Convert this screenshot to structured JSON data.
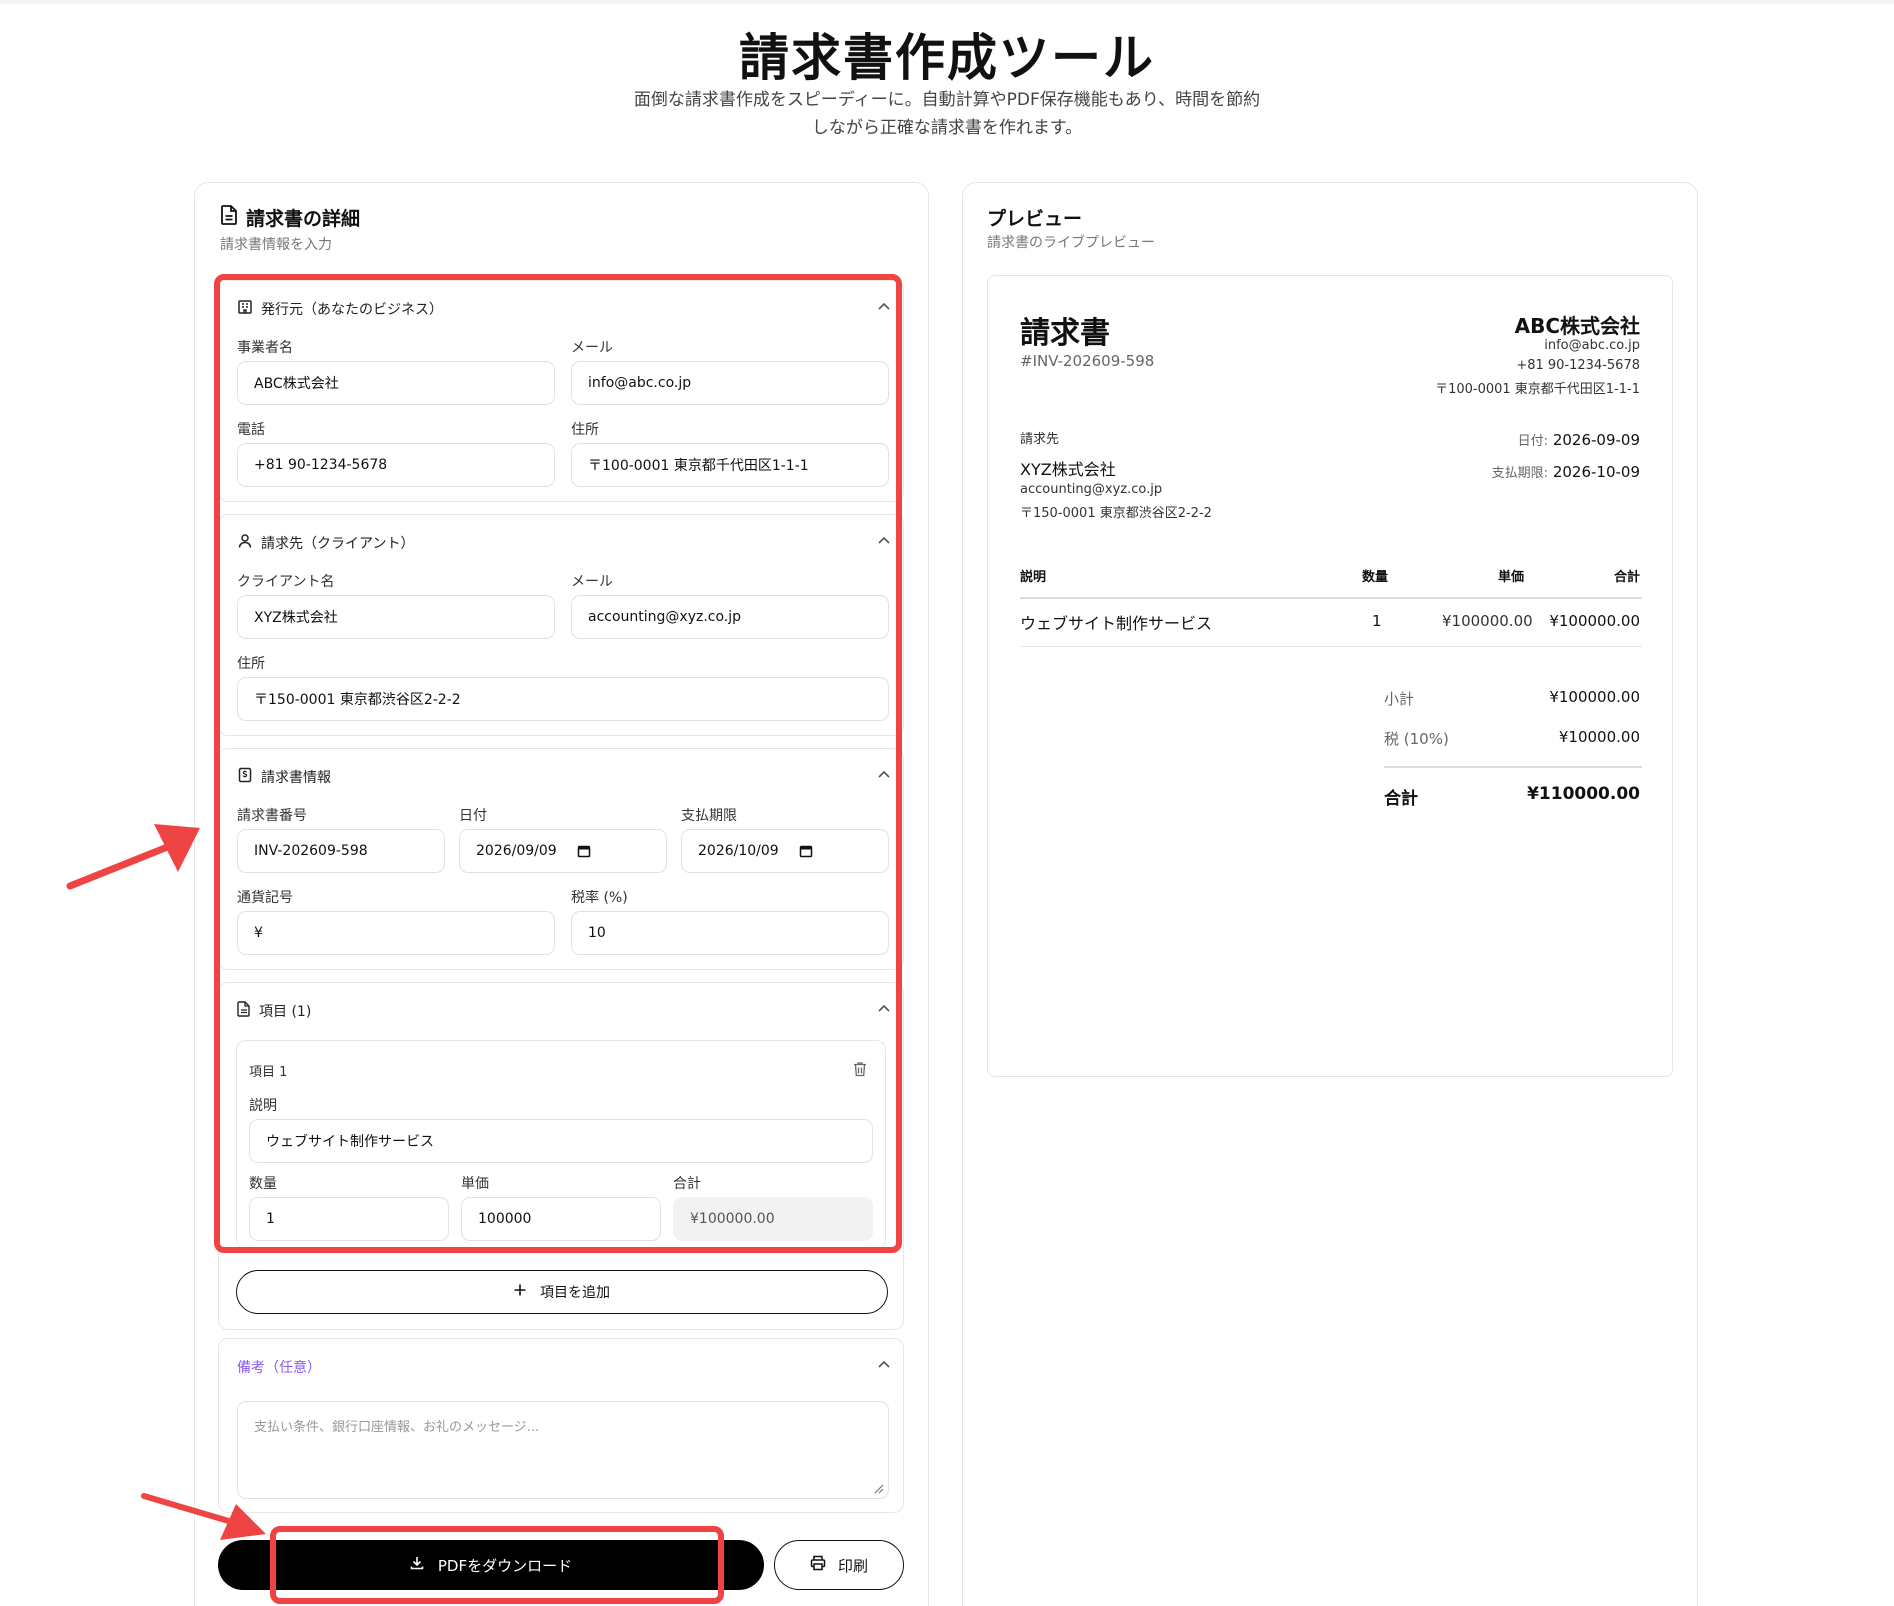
{
  "page": {
    "title": "請求書作成ツール",
    "subtitle_line1": "面倒な請求書作成をスピーディーに。自動計算やPDF保存機能もあり、時間を節約",
    "subtitle_line2": "しながら正確な請求書を作れます。"
  },
  "form": {
    "title": "請求書の詳細",
    "subtitle": "請求書情報を入力",
    "issuer": {
      "section_title": "発行元（あなたのビジネス）",
      "business_name_label": "事業者名",
      "business_name": "ABC株式会社",
      "email_label": "メール",
      "email": "info@abc.co.jp",
      "phone_label": "電話",
      "phone": "+81 90-1234-5678",
      "address_label": "住所",
      "address": "〒100-0001 東京都千代田区1-1-1"
    },
    "client": {
      "section_title": "請求先（クライアント）",
      "name_label": "クライアント名",
      "name": "XYZ株式会社",
      "email_label": "メール",
      "email": "accounting@xyz.co.jp",
      "address_label": "住所",
      "address": "〒150-0001 東京都渋谷区2-2-2"
    },
    "invoice": {
      "section_title": "請求書情報",
      "number_label": "請求書番号",
      "number": "INV-202609-598",
      "date_label": "日付",
      "date": "2026/09/09",
      "due_label": "支払期限",
      "due": "2026/10/09",
      "currency_label": "通貨記号",
      "currency": "¥",
      "tax_label": "税率 (%)",
      "tax": "10"
    },
    "items": {
      "section_title": "項目 (1)",
      "item_title": "項目 1",
      "description_label": "説明",
      "description": "ウェブサイト制作サービス",
      "qty_label": "数量",
      "qty": "1",
      "price_label": "単価",
      "price": "100000",
      "total_label": "合計",
      "total": "¥100000.00",
      "add_button": "項目を追加"
    },
    "notes": {
      "title": "備考（任意）",
      "placeholder": "支払い条件、銀行口座情報、お礼のメッセージ..."
    },
    "pdf_button": "PDFをダウンロード",
    "print_button": "印刷"
  },
  "preview": {
    "title": "プレビュー",
    "subtitle": "請求書のライブプレビュー",
    "doc_title": "請求書",
    "doc_number": "#INV-202609-598",
    "issuer_name": "ABC株式会社",
    "issuer_email": "info@abc.co.jp",
    "issuer_phone": "+81 90-1234-5678",
    "issuer_address": "〒100-0001 東京都千代田区1-1-1",
    "bill_to_label": "請求先",
    "client_name": "XYZ株式会社",
    "client_email": "accounting@xyz.co.jp",
    "client_address": "〒150-0001 東京都渋谷区2-2-2",
    "date_label": "日付:",
    "date": "2026-09-09",
    "due_label": "支払期限:",
    "due": "2026-10-09",
    "table_headers": [
      "説明",
      "数量",
      "単価",
      "合計"
    ],
    "row": {
      "description": "ウェブサイト制作サービス",
      "qty": "1",
      "price": "¥100000.00",
      "total": "¥100000.00"
    },
    "subtotal_label": "小計",
    "subtotal": "¥100000.00",
    "tax_label": "税 (10%)",
    "tax": "¥10000.00",
    "grand_label": "合計",
    "grand": "¥110000.00"
  },
  "colors": {
    "annotation": "#ef4444",
    "notes_title": "#8b5cf6",
    "primary_button": "#000000"
  }
}
